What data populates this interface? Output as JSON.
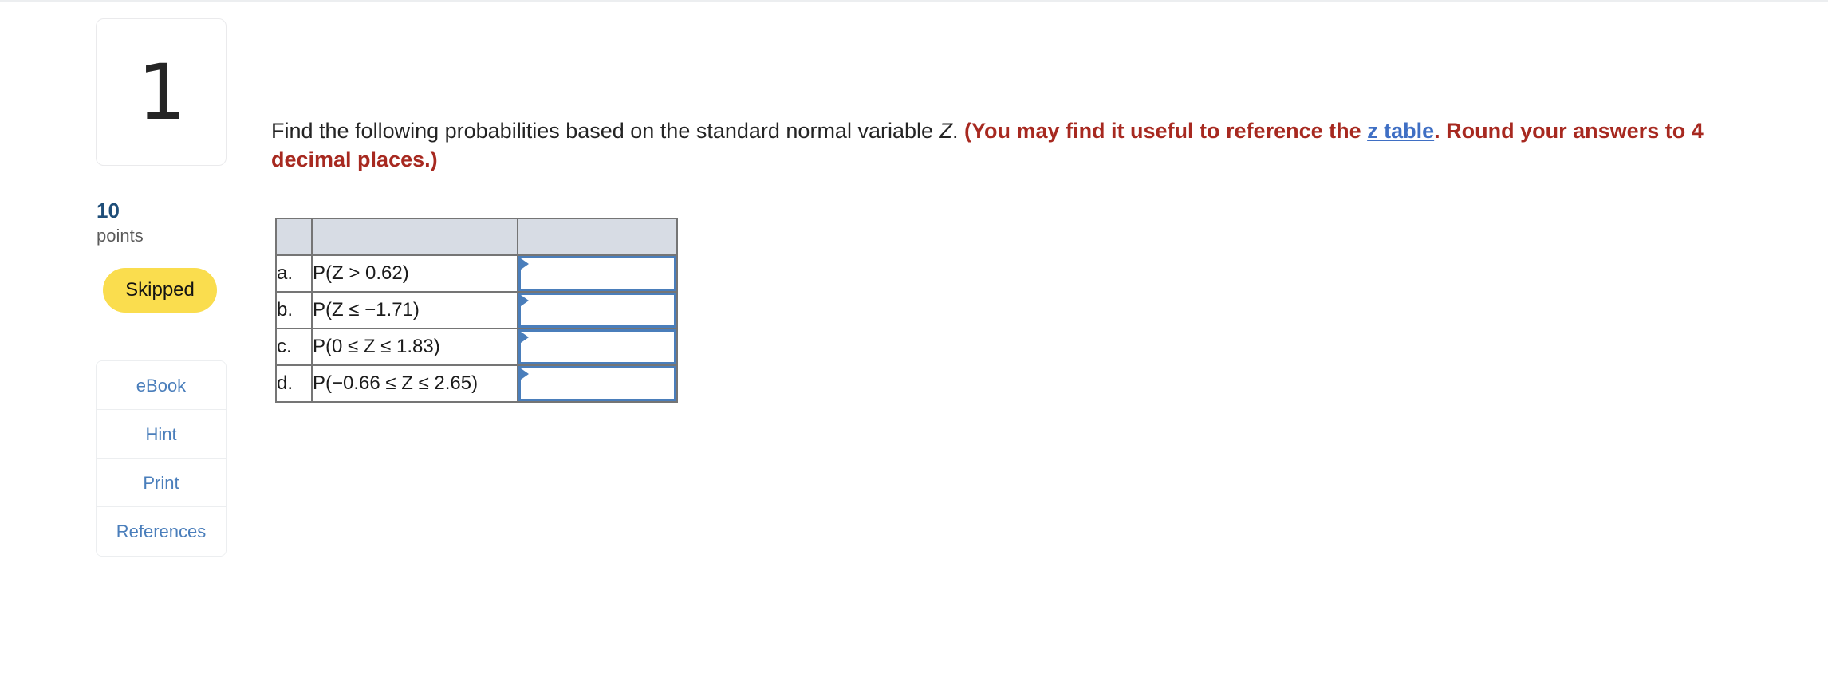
{
  "question": {
    "number": "1",
    "points_value": "10",
    "points_label": "points",
    "status": "Skipped"
  },
  "tools": {
    "ebook": "eBook",
    "hint": "Hint",
    "print": "Print",
    "references": "References"
  },
  "prompt": {
    "lead": "Find the following probabilities based on the standard normal variable ",
    "variable": "Z",
    "period": ".",
    "hint_part1": "(You may find it useful to reference the ",
    "link_text": "z table",
    "hint_part2": ". Round your answers to 4 decimal places.)"
  },
  "answer_table": {
    "headers": [
      "",
      "",
      ""
    ],
    "rows": [
      {
        "letter": "a.",
        "expression": "P(Z > 0.62)",
        "answer": "",
        "placeholder": ""
      },
      {
        "letter": "b.",
        "expression": "P(Z ≤ −1.71)",
        "answer": "",
        "placeholder": ""
      },
      {
        "letter": "c.",
        "expression": "P(0 ≤ Z ≤ 1.83)",
        "answer": "",
        "placeholder": ""
      },
      {
        "letter": "d.",
        "expression": "P(−0.66 ≤ Z ≤ 2.65)",
        "answer": "",
        "placeholder": ""
      }
    ]
  },
  "colors": {
    "hint_red": "#a72920",
    "link_blue": "#3f6fc4",
    "badge_yellow": "#fadd4e",
    "input_border_blue": "#4a7ebb",
    "points_blue": "#1f4e79",
    "table_header_fill": "#d7dce4"
  }
}
